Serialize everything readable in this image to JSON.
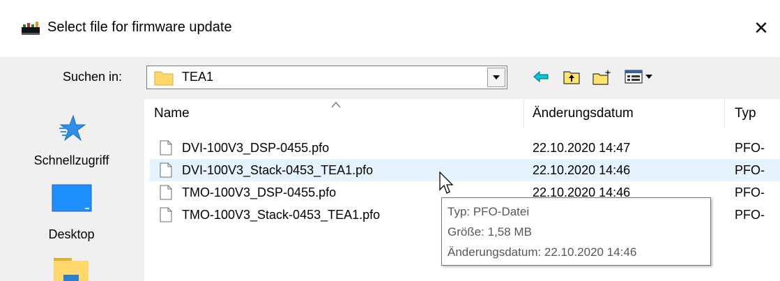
{
  "window": {
    "title": "Select file for firmware update",
    "close_glyph": "✕"
  },
  "toolbar": {
    "lookin_label": "Suchen in:",
    "lookin_value": "TEA1",
    "buttons": [
      {
        "name": "back-icon"
      },
      {
        "name": "up-folder-icon"
      },
      {
        "name": "new-folder-icon"
      },
      {
        "name": "view-menu-icon"
      }
    ]
  },
  "places": [
    {
      "label": "Schnellzugriff",
      "icon": "star-icon"
    },
    {
      "label": "Desktop",
      "icon": "desktop-icon"
    },
    {
      "label": "",
      "icon": "folder-icon"
    }
  ],
  "columns": {
    "name": "Name",
    "date": "Änderungsdatum",
    "type": "Typ"
  },
  "files": [
    {
      "name": "DVI-100V3_DSP-0455.pfo",
      "date": "22.10.2020 14:47",
      "type": "PFO-"
    },
    {
      "name": "DVI-100V3_Stack-0453_TEA1.pfo",
      "date": "22.10.2020 14:46",
      "type": "PFO-"
    },
    {
      "name": "TMO-100V3_DSP-0455.pfo",
      "date": "22.10.2020 14:46",
      "type": "PFO-"
    },
    {
      "name": "TMO-100V3_Stack-0453_TEA1.pfo",
      "date": "",
      "type": "PFO-"
    }
  ],
  "tooltip": {
    "type": "Typ: PFO-Datei",
    "size": "Größe: 1,58 MB",
    "date": "Änderungsdatum: 22.10.2020 14:46"
  },
  "colors": {
    "hover_row": "#e5f3ff",
    "accent_blue": "#1e90ff",
    "folder_yellow": "#ffd76a"
  }
}
